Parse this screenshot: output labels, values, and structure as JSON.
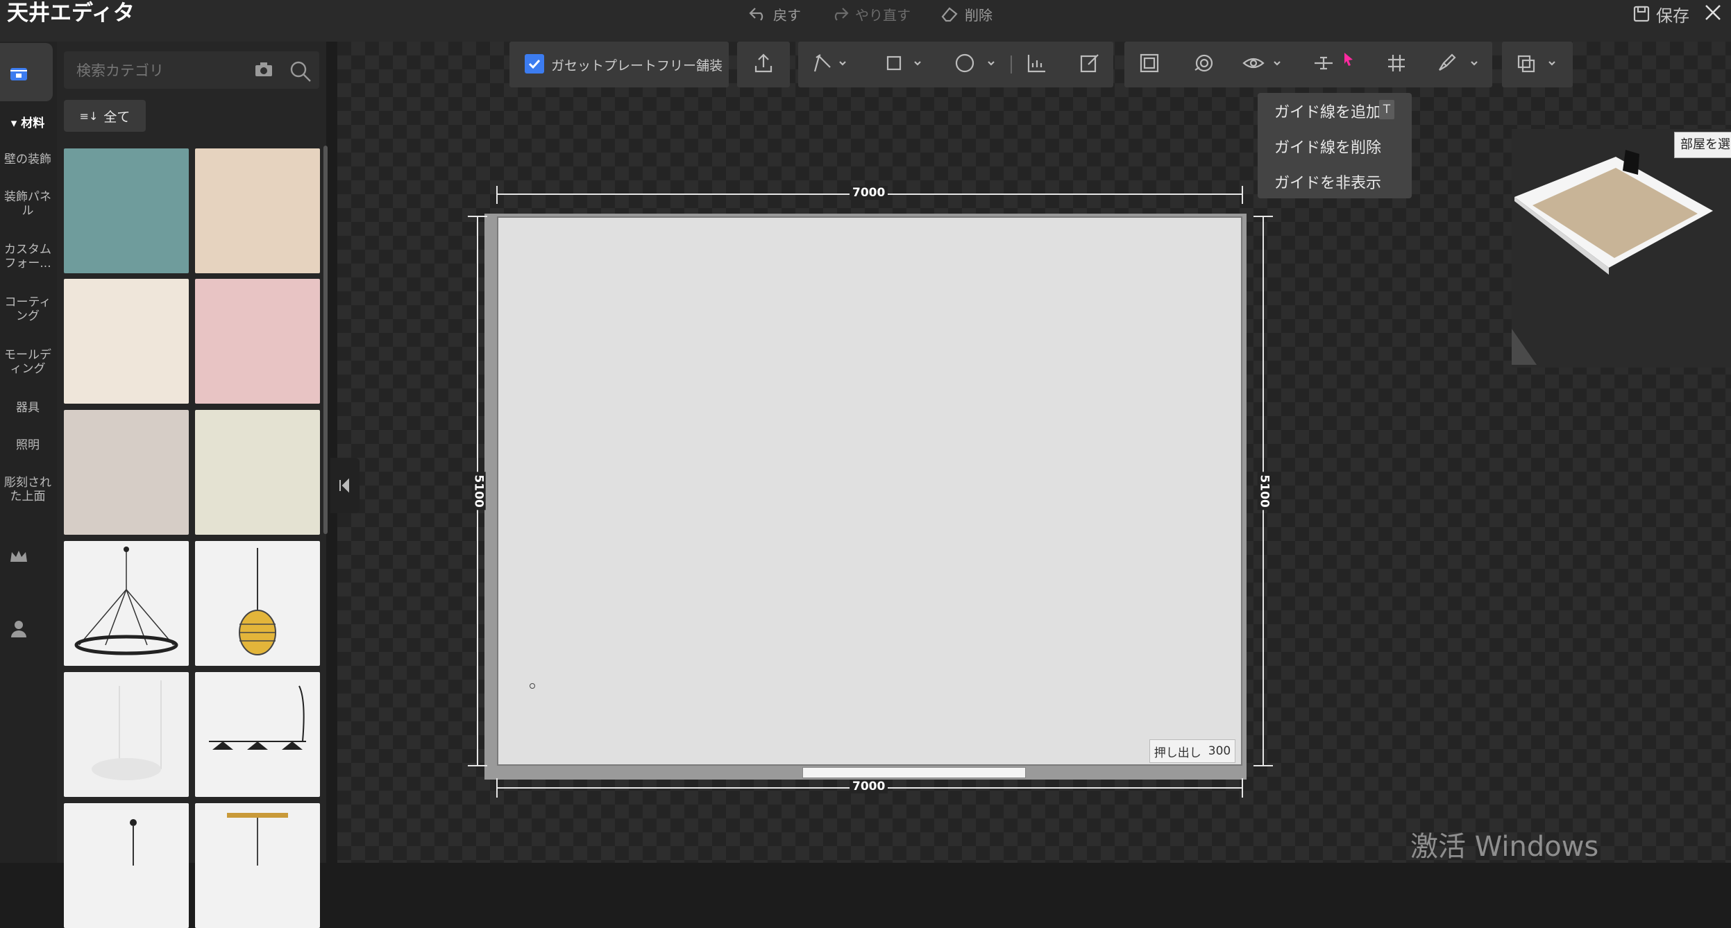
{
  "app": {
    "title": "天井エディタ"
  },
  "topbar": {
    "undo": "戻す",
    "redo": "やり直す",
    "delete": "削除",
    "save": "保存"
  },
  "sidebar": {
    "items": [
      {
        "label": "材料",
        "icon": "store-icon"
      },
      {
        "label": "壁の装飾"
      },
      {
        "label": "装飾パネ\nル"
      },
      {
        "label": "カスタム\nフォー..."
      },
      {
        "label": "コーティ\nング"
      },
      {
        "label": "モールデ\nィング"
      },
      {
        "label": "器具"
      },
      {
        "label": "照明"
      },
      {
        "label": "彫刻され\nた上面"
      }
    ],
    "bottom_icons": [
      "crown-icon",
      "user-icon"
    ]
  },
  "panel": {
    "search_placeholder": "検索カテゴリ",
    "filter_label": "全て",
    "tiles": [
      {
        "kind": "swatch",
        "color": "#6f9c9c"
      },
      {
        "kind": "swatch",
        "color": "#e6d3bf"
      },
      {
        "kind": "swatch",
        "color": "#efe6da"
      },
      {
        "kind": "swatch",
        "color": "#e8c4c4"
      },
      {
        "kind": "swatch",
        "color": "#d6cdc6"
      },
      {
        "kind": "swatch",
        "color": "#e4e2d2"
      },
      {
        "kind": "product",
        "icon": "ring-chandelier-icon"
      },
      {
        "kind": "product",
        "icon": "pendant-lamp-icon"
      },
      {
        "kind": "product",
        "icon": "white-chandelier-icon"
      },
      {
        "kind": "product",
        "icon": "triple-pendant-icon"
      },
      {
        "kind": "product",
        "icon": "pendant-small-icon"
      },
      {
        "kind": "product",
        "icon": "bar-light-icon"
      }
    ]
  },
  "toolbar": {
    "gusset_checkbox": {
      "label": "ガセットプレートフリー舗装",
      "checked": true
    }
  },
  "guide_menu": {
    "items": [
      "ガイド線を追加",
      "ガイド線を削除",
      "ガイドを非表示"
    ],
    "shortcut": "T"
  },
  "canvas": {
    "dim_top": "7000",
    "dim_bottom": "7000",
    "dim_left": "5100",
    "dim_right": "5100",
    "extrude_label": "押し出し",
    "extrude_value": "300"
  },
  "preview": {
    "tooltip": "部屋を選"
  },
  "watermark": "激活 Windows",
  "colors": {
    "accent": "#3c7cf0",
    "highlight": "#ff2aa0"
  }
}
